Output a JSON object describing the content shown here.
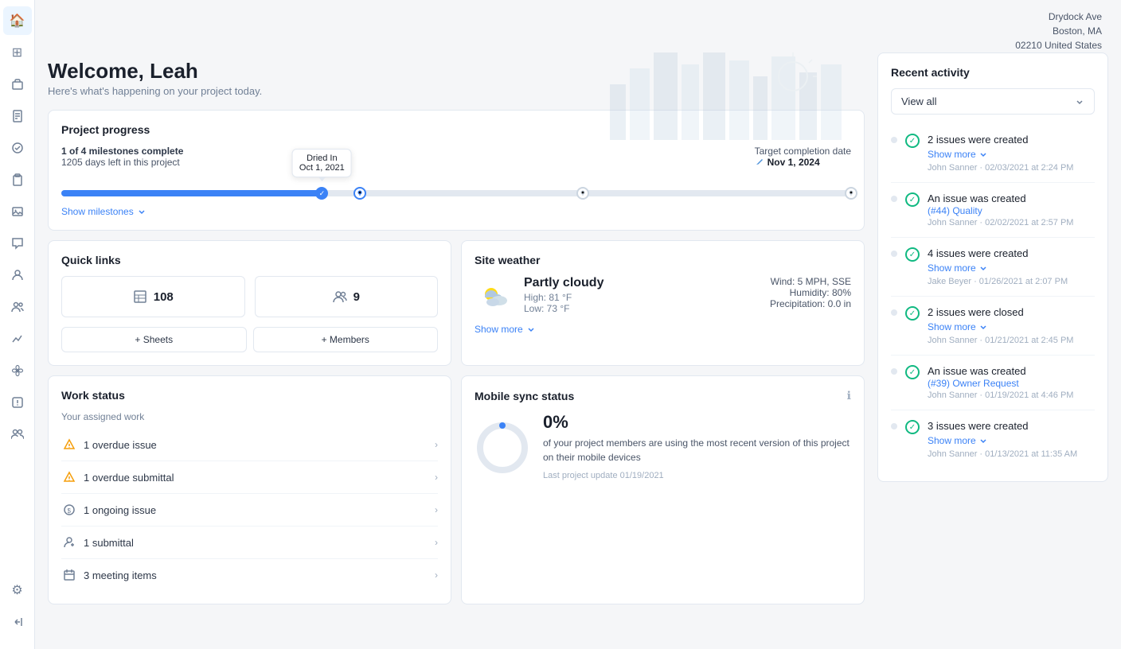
{
  "header": {
    "address_line1": "Drydock Ave",
    "address_line2": "Boston, MA",
    "address_line3": "02210 United States"
  },
  "welcome": {
    "title": "Welcome, Leah",
    "subtitle": "Here's what's happening on your project today."
  },
  "project_progress": {
    "title": "Project progress",
    "milestones_complete": "1 of 4 milestones complete",
    "days_left": "1205 days left in this project",
    "target_label": "Target completion date",
    "target_date": "Nov 1, 2024",
    "tooltip_line1": "Dried In",
    "tooltip_line2": "Oct 1, 2021",
    "show_milestones": "Show milestones",
    "fill_percent": 33
  },
  "quick_links": {
    "title": "Quick links",
    "sheets_count": "108",
    "members_count": "9",
    "sheets_label": "+ Sheets",
    "members_label": "+ Members"
  },
  "site_weather": {
    "title": "Site weather",
    "condition": "Partly cloudy",
    "high": "High: 81 °F",
    "low": "Low: 73 °F",
    "wind": "Wind: 5 MPH, SSE",
    "humidity": "Humidity: 80%",
    "precipitation": "Precipitation: 0.0 in",
    "show_more": "Show more"
  },
  "work_status": {
    "title": "Work status",
    "assigned_label": "Your assigned work",
    "items": [
      {
        "icon": "warning",
        "label": "1 overdue issue"
      },
      {
        "icon": "warning",
        "label": "1 overdue submittal"
      },
      {
        "icon": "dollar",
        "label": "1 ongoing issue"
      },
      {
        "icon": "person",
        "label": "1 submittal"
      },
      {
        "icon": "calendar",
        "label": "3 meeting items"
      }
    ]
  },
  "mobile_sync": {
    "title": "Mobile sync status",
    "percent": "0%",
    "description": "of your project members are using the most recent version of this project on their mobile devices",
    "last_update": "Last project update 01/19/2021"
  },
  "recent_activity": {
    "title": "Recent activity",
    "filter_label": "View all",
    "items": [
      {
        "title": "2 issues were created",
        "show_more": "Show more",
        "meta": "John Sanner · 02/03/2021 at 2:24 PM"
      },
      {
        "title": "An issue was created",
        "link": "(#44) Quality",
        "show_more": null,
        "meta": "John Sanner · 02/02/2021 at 2:57 PM"
      },
      {
        "title": "4 issues were created",
        "show_more": "Show more",
        "meta": "Jake Beyer · 01/26/2021 at 2:07 PM"
      },
      {
        "title": "2 issues were closed",
        "show_more": "Show more",
        "meta": "John Sanner · 01/21/2021 at 2:45 PM"
      },
      {
        "title": "An issue was created",
        "link": "(#39) Owner Request",
        "show_more": null,
        "meta": "John Sanner · 01/19/2021 at 4:46 PM"
      },
      {
        "title": "3 issues were created",
        "show_more": "Show more",
        "meta": "John Sanner · 01/13/2021 at 11:35 AM"
      }
    ]
  },
  "sidebar": {
    "items": [
      {
        "icon": "🏠",
        "name": "home",
        "active": true
      },
      {
        "icon": "⊞",
        "name": "grid"
      },
      {
        "icon": "📦",
        "name": "box"
      },
      {
        "icon": "📄",
        "name": "document"
      },
      {
        "icon": "✓",
        "name": "check"
      },
      {
        "icon": "📋",
        "name": "clipboard"
      },
      {
        "icon": "🖼",
        "name": "image"
      },
      {
        "icon": "💬",
        "name": "chat"
      },
      {
        "icon": "👤",
        "name": "user-single"
      },
      {
        "icon": "👥",
        "name": "users-group"
      },
      {
        "icon": "📈",
        "name": "analytics"
      },
      {
        "icon": "✿",
        "name": "flower"
      },
      {
        "icon": "⊙",
        "name": "circle-dot"
      },
      {
        "icon": "👤",
        "name": "people"
      }
    ],
    "bottom_items": [
      {
        "icon": "⚙",
        "name": "settings"
      },
      {
        "icon": "→|",
        "name": "collapse"
      }
    ]
  }
}
